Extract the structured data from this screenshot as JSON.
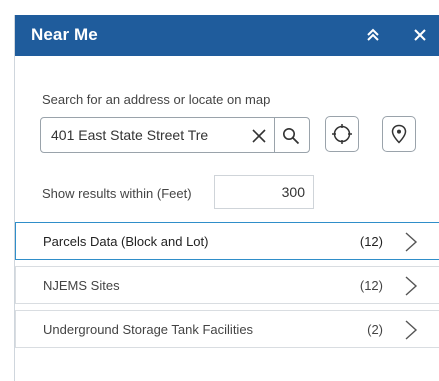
{
  "header": {
    "title": "Near Me",
    "collapse_icon": "double-chevron-up-icon",
    "close_icon": "close-icon"
  },
  "search": {
    "label": "Search for an address or locate on map",
    "value": "401 East State Street Tre",
    "clear_icon": "close-icon",
    "search_icon": "search-icon"
  },
  "tools": {
    "locate_icon": "crosshair-icon",
    "map_point_icon": "map-pin-icon"
  },
  "distance": {
    "label": "Show results within (Feet)",
    "value": "300"
  },
  "results": [
    {
      "label": "Parcels Data (Block and Lot)",
      "count": "(12)",
      "active": true
    },
    {
      "label": "NJEMS Sites",
      "count": "(12)",
      "active": false
    },
    {
      "label": "Underground Storage Tank Facilities",
      "count": "(2)",
      "active": false
    }
  ],
  "colors": {
    "header_bg": "#1f5c9c",
    "active_border": "#2f8ec9"
  }
}
